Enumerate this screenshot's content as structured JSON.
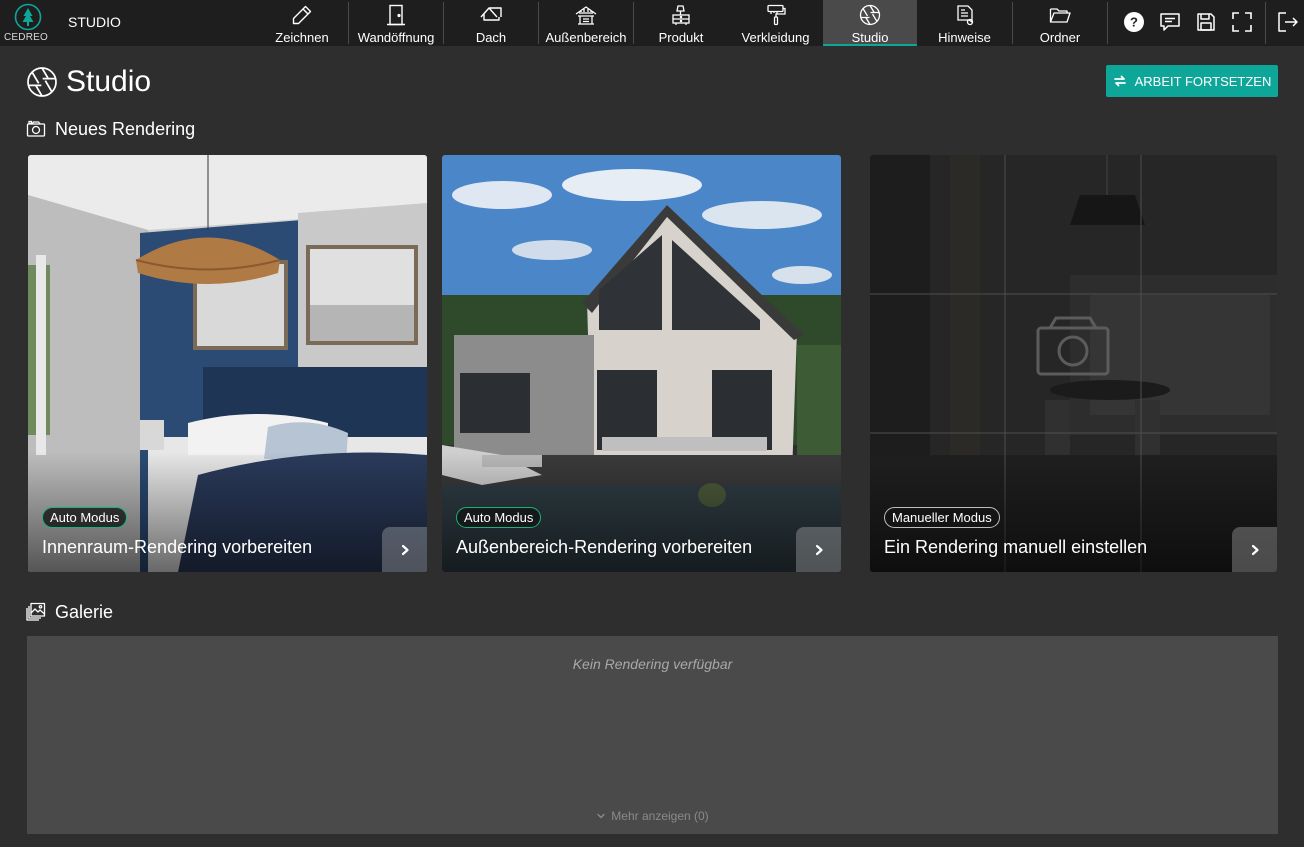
{
  "app": {
    "brand_name": "CEDREO",
    "section": "STUDIO"
  },
  "nav": {
    "items": [
      {
        "label": "Zeichnen",
        "icon": "pencil-icon"
      },
      {
        "label": "Wandöffnung",
        "icon": "door-icon"
      },
      {
        "label": "Dach",
        "icon": "roof-icon"
      },
      {
        "label": "Außenbereich",
        "icon": "pergola-icon"
      },
      {
        "label": "Produkt",
        "icon": "furniture-icon"
      },
      {
        "label": "Verkleidung",
        "icon": "paint-roller-icon"
      },
      {
        "label": "Studio",
        "icon": "aperture-icon",
        "active": true
      },
      {
        "label": "Hinweise",
        "icon": "annotation-icon"
      },
      {
        "label": "Ordner",
        "icon": "folder-icon"
      }
    ],
    "tools": [
      "help-icon",
      "comment-icon",
      "save-icon",
      "fullscreen-icon",
      "logout-icon"
    ]
  },
  "page": {
    "title": "Studio",
    "continue_button": "ARBEIT FORTSETZEN"
  },
  "new_rendering": {
    "title": "Neues Rendering",
    "cards": [
      {
        "badge": "Auto Modus",
        "title": "Innenraum-Rendering vorbereiten"
      },
      {
        "badge": "Auto Modus",
        "title": "Außenbereich-Rendering vorbereiten"
      },
      {
        "badge": "Manueller Modus",
        "title": "Ein Rendering manuell einstellen"
      }
    ]
  },
  "gallery": {
    "title": "Galerie",
    "empty_text": "Kein Rendering verfügbar",
    "show_more": "Mehr anzeigen (0)"
  },
  "colors": {
    "accent": "#0fa69a",
    "topbar": "#1e1e1e",
    "background": "#2e2e2e",
    "gallery_panel": "#4a4a4a",
    "badge_auto_border": "#1bb17a"
  }
}
